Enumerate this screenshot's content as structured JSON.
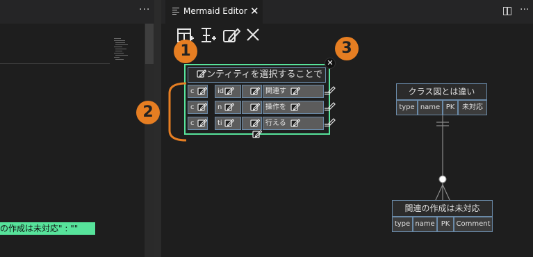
{
  "left": {
    "more_glyph": "···",
    "highlight_text": "の作成は未対応\" : \"\""
  },
  "tab": {
    "title": "Mermaid Editor",
    "close_glyph": "✕"
  },
  "toolbar": {
    "icons": [
      "add-entity-icon",
      "add-attribute-icon",
      "edit-icon",
      "close-icon"
    ],
    "close_glyph": "✕"
  },
  "editor": {
    "more_glyph": "···"
  },
  "entity": {
    "title": "ンティティを選択することで",
    "rows": [
      [
        "c",
        "id",
        "",
        "関連す"
      ],
      [
        "c",
        "n",
        "",
        "操作を"
      ],
      [
        "c",
        "ti",
        "",
        "行える"
      ]
    ],
    "close_glyph": "✕"
  },
  "badges": [
    "1",
    "2",
    "3"
  ],
  "diagram": {
    "entity1": {
      "title": "クラス図とは違い",
      "columns": [
        "type",
        "name",
        "PK",
        "未対応"
      ]
    },
    "entity2": {
      "title": "関連の作成は未対応",
      "columns": [
        "type",
        "name",
        "PK",
        "Comment"
      ]
    }
  },
  "colors": {
    "accent_green": "#57e39b",
    "badge_orange": "#e67e22",
    "entity_border": "#6a8aa8"
  }
}
